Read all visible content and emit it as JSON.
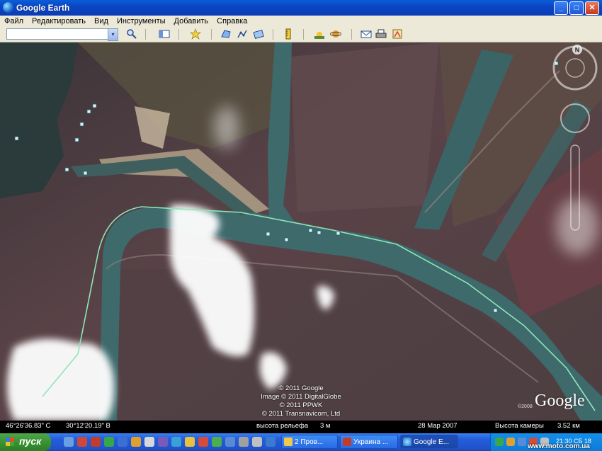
{
  "window": {
    "title": "Google Earth",
    "minimize": "_",
    "maximize": "□",
    "close": "✕"
  },
  "menu": [
    "Файл",
    "Редактировать",
    "Вид",
    "Инструменты",
    "Добавить",
    "Справка"
  ],
  "toolbar": {
    "search_value": "",
    "dropdown_glyph": "▾",
    "icons": [
      "search-icon",
      "sidebar-toggle-icon",
      "placemark-icon",
      "polygon-icon",
      "path-icon",
      "image-overlay-icon",
      "ruler-icon",
      "sunlight-icon",
      "planet-icon",
      "email-icon",
      "print-icon",
      "view-in-maps-icon"
    ]
  },
  "map": {
    "compass_label": "N",
    "attribution": [
      "© 2011 Google",
      "Image © 2011 DigitalGlobe",
      "© 2011 PPWK",
      "© 2011 Transnavicom, Ltd"
    ],
    "logo": "Google",
    "logo_year": "©2008"
  },
  "status": {
    "lat": "46°26'36.83\" С",
    "lon": "30°12'20.19\" В",
    "elev_label": "высота рельефа",
    "elev_value": "3 м",
    "date": "28 Мар 2007",
    "eye_label": "Высота камеры",
    "eye_value": "3.52 км"
  },
  "taskbar": {
    "start_label": "пуск",
    "tasks": [
      "2 Пров...",
      "Украина ...",
      "Google E..."
    ],
    "clock": "21:30  СБ 18",
    "watermark": "www.moto.com.ua"
  },
  "colors": {
    "water": "#3e6a6c",
    "land_dark": "#4a3a3c",
    "cloud": "#ffffff",
    "route_line": "#8ee6b6",
    "title_bar": "#0b45c4",
    "taskbar": "#245edb"
  }
}
